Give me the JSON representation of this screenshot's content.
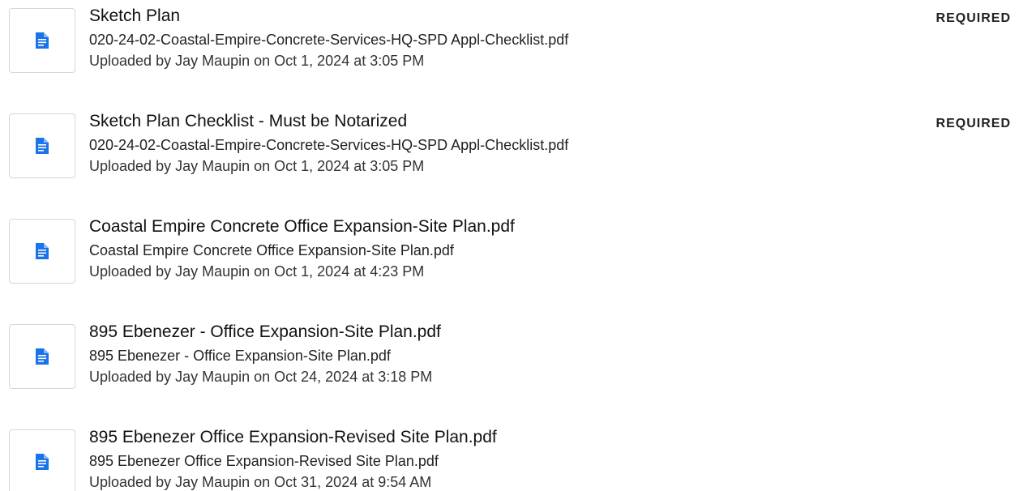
{
  "documents": [
    {
      "title": "Sketch Plan",
      "filename": "020-24-02-Coastal-Empire-Concrete-Services-HQ-SPD Appl-Checklist.pdf",
      "uploaded": "Uploaded by Jay Maupin on Oct 1, 2024 at 3:05 PM",
      "badge": "REQUIRED",
      "icon": "document-icon"
    },
    {
      "title": "Sketch Plan Checklist - Must be Notarized",
      "filename": "020-24-02-Coastal-Empire-Concrete-Services-HQ-SPD Appl-Checklist.pdf",
      "uploaded": "Uploaded by Jay Maupin on Oct 1, 2024 at 3:05 PM",
      "badge": "REQUIRED",
      "icon": "document-icon"
    },
    {
      "title": "Coastal Empire Concrete Office Expansion-Site Plan.pdf",
      "filename": "Coastal Empire Concrete Office Expansion-Site Plan.pdf",
      "uploaded": "Uploaded by Jay Maupin on Oct 1, 2024 at 4:23 PM",
      "badge": "",
      "icon": "document-icon"
    },
    {
      "title": "895 Ebenezer - Office Expansion-Site Plan.pdf",
      "filename": "895 Ebenezer - Office Expansion-Site Plan.pdf",
      "uploaded": "Uploaded by Jay Maupin on Oct 24, 2024 at 3:18 PM",
      "badge": "",
      "icon": "document-icon"
    },
    {
      "title": "895 Ebenezer Office Expansion-Revised Site Plan.pdf",
      "filename": "895 Ebenezer Office Expansion-Revised Site Plan.pdf",
      "uploaded": "Uploaded by Jay Maupin on Oct 31, 2024 at 9:54 AM",
      "badge": "",
      "icon": "document-icon"
    }
  ],
  "colors": {
    "icon": "#1a73e8",
    "thumb_border": "#d6d6d6"
  }
}
